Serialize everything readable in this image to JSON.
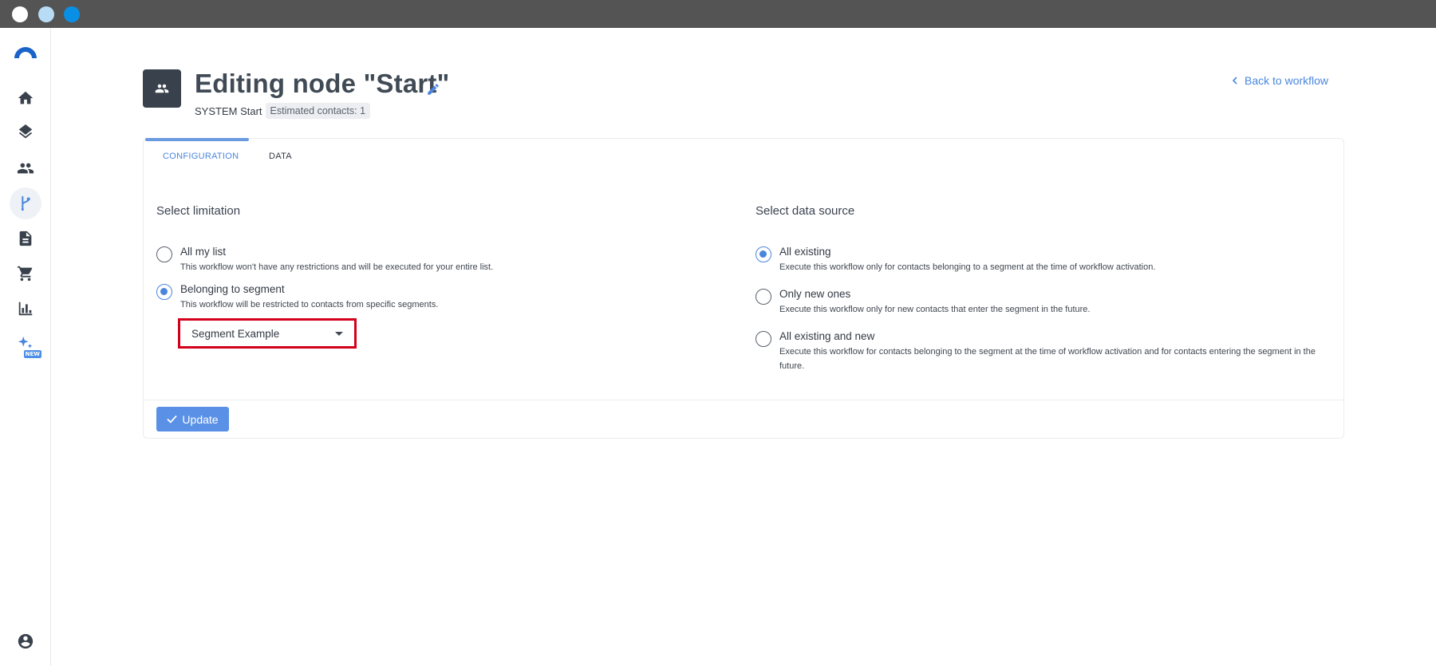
{
  "window": {
    "controls": [
      "close",
      "minimize",
      "maximize"
    ]
  },
  "sidebar": {
    "logo_icon": "app-logo",
    "items": [
      {
        "name": "home",
        "icon": "home-icon"
      },
      {
        "name": "layers",
        "icon": "layers-icon"
      },
      {
        "name": "contacts",
        "icon": "people-icon"
      },
      {
        "name": "workflows",
        "icon": "branch-icon",
        "active": true
      },
      {
        "name": "documents",
        "icon": "document-icon"
      },
      {
        "name": "ecommerce",
        "icon": "cart-icon"
      },
      {
        "name": "reports",
        "icon": "bar-chart-icon"
      },
      {
        "name": "ai",
        "icon": "sparkles-icon",
        "badge": "NEW"
      }
    ],
    "account_icon": "account-icon"
  },
  "header": {
    "title": "Editing node \"Start\"",
    "node_type": "SYSTEM Start",
    "estimate": "Estimated contacts: 1",
    "back_label": "Back to workflow"
  },
  "tabs": [
    {
      "label": "CONFIGURATION",
      "active": true
    },
    {
      "label": "DATA",
      "active": false
    }
  ],
  "limitation": {
    "title": "Select limitation",
    "options": [
      {
        "label": "All my list",
        "desc": "This workflow won't have any restrictions and will be executed for your entire list.",
        "checked": false
      },
      {
        "label": "Belonging to segment",
        "desc": "This workflow will be restricted to contacts from specific segments.",
        "checked": true
      }
    ],
    "segment_value": "Segment Example"
  },
  "data_source": {
    "title": "Select data source",
    "options": [
      {
        "label": "All existing",
        "desc": "Execute this workflow only for contacts belonging to a segment at the time of workflow activation.",
        "checked": true
      },
      {
        "label": "Only new ones",
        "desc": "Execute this workflow only for new contacts that enter the segment in the future.",
        "checked": false
      },
      {
        "label": "All existing and new",
        "desc": "Execute this workflow for contacts belonging to the segment at the time of workflow activation and for contacts entering the segment in the future.",
        "checked": false
      }
    ]
  },
  "footer": {
    "update_label": "Update"
  },
  "colors": {
    "accent": "#4a86dd",
    "highlight": "#d3001b",
    "button": "#5a91e6"
  }
}
